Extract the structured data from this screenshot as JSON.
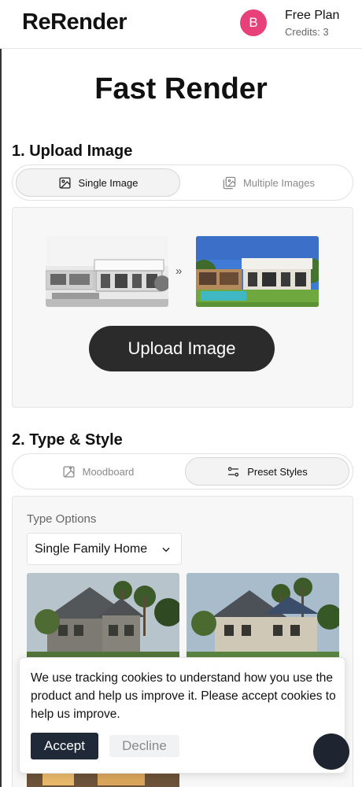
{
  "header": {
    "logo": "ReRender",
    "avatar_initial": "B",
    "plan": "Free Plan",
    "credits": "Credits: 3"
  },
  "page_title": "Fast Render",
  "upload_section": {
    "heading": "1. Upload Image",
    "tabs": [
      {
        "label": "Single Image",
        "icon": "image-icon",
        "active": true
      },
      {
        "label": "Multiple Images",
        "icon": "images-icon",
        "active": false
      }
    ],
    "arrows": "»",
    "upload_button": "Upload Image"
  },
  "style_section": {
    "heading": "2. Type & Style",
    "tabs": [
      {
        "label": "Moodboard",
        "icon": "image-upload-icon",
        "active": false
      },
      {
        "label": "Preset Styles",
        "icon": "sliders-icon",
        "active": true
      }
    ],
    "type_options_label": "Type Options",
    "type_selected": "Single Family Home"
  },
  "cookie_banner": {
    "text": "We use tracking cookies to understand how you use the product and help us improve it. Please accept cookies to help us improve.",
    "accept": "Accept",
    "decline": "Decline"
  },
  "colors": {
    "avatar": "#e8417a",
    "primary_button": "#2b2b2b",
    "accept_button": "#1f2937"
  }
}
